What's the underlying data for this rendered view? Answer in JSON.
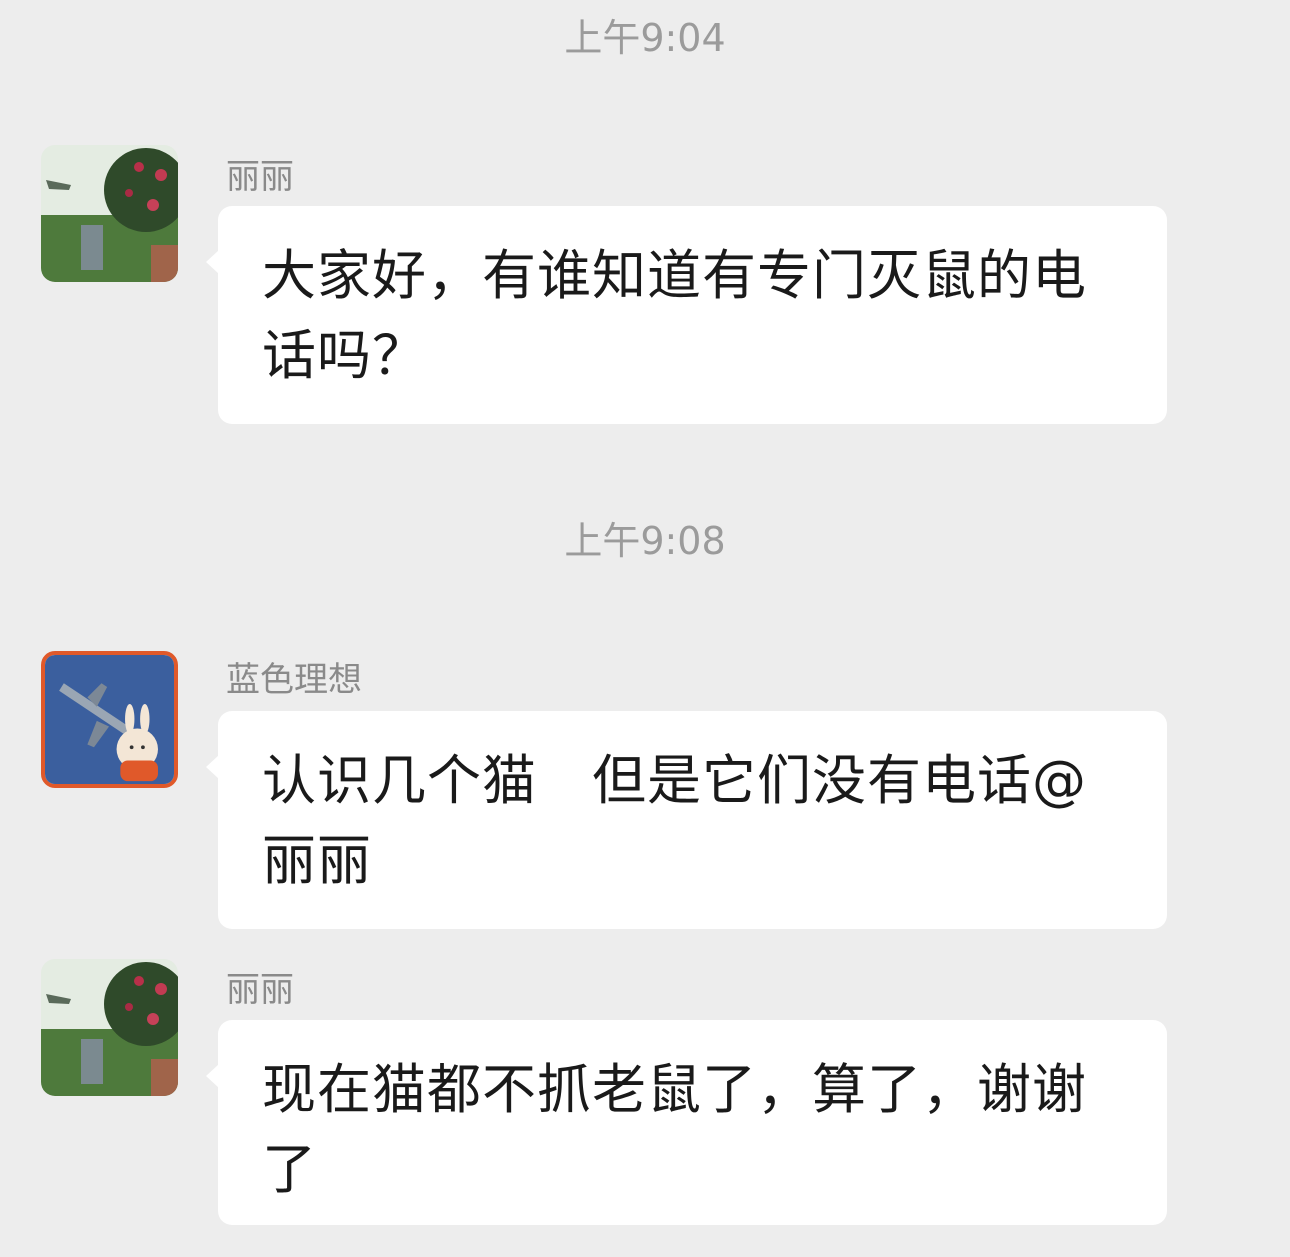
{
  "timestamps": [
    "上午9:04",
    "上午9:08"
  ],
  "messages": [
    {
      "sender": "丽丽",
      "text": "大家好，有谁知道有专门灭鼠的电话吗？"
    },
    {
      "sender": "蓝色理想",
      "text": "认识几个猫　但是它们没有电话@丽丽"
    },
    {
      "sender": "丽丽",
      "text": "现在猫都不抓老鼠了，算了，谢谢了"
    }
  ]
}
